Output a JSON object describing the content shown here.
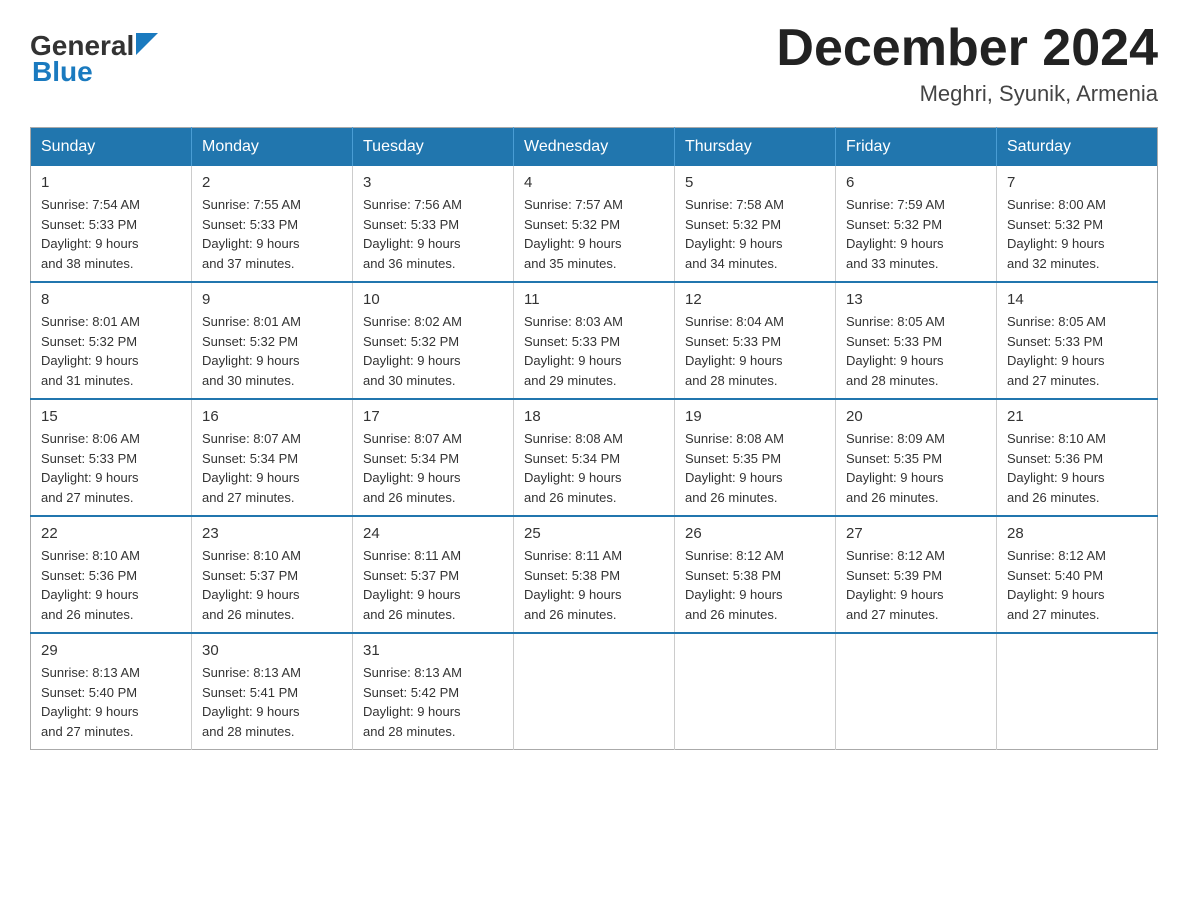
{
  "logo": {
    "general": "General",
    "blue": "Blue"
  },
  "title": "December 2024",
  "subtitle": "Meghri, Syunik, Armenia",
  "weekdays": [
    "Sunday",
    "Monday",
    "Tuesday",
    "Wednesday",
    "Thursday",
    "Friday",
    "Saturday"
  ],
  "weeks": [
    [
      {
        "day": "1",
        "sunrise": "7:54 AM",
        "sunset": "5:33 PM",
        "daylight": "9 hours and 38 minutes."
      },
      {
        "day": "2",
        "sunrise": "7:55 AM",
        "sunset": "5:33 PM",
        "daylight": "9 hours and 37 minutes."
      },
      {
        "day": "3",
        "sunrise": "7:56 AM",
        "sunset": "5:33 PM",
        "daylight": "9 hours and 36 minutes."
      },
      {
        "day": "4",
        "sunrise": "7:57 AM",
        "sunset": "5:32 PM",
        "daylight": "9 hours and 35 minutes."
      },
      {
        "day": "5",
        "sunrise": "7:58 AM",
        "sunset": "5:32 PM",
        "daylight": "9 hours and 34 minutes."
      },
      {
        "day": "6",
        "sunrise": "7:59 AM",
        "sunset": "5:32 PM",
        "daylight": "9 hours and 33 minutes."
      },
      {
        "day": "7",
        "sunrise": "8:00 AM",
        "sunset": "5:32 PM",
        "daylight": "9 hours and 32 minutes."
      }
    ],
    [
      {
        "day": "8",
        "sunrise": "8:01 AM",
        "sunset": "5:32 PM",
        "daylight": "9 hours and 31 minutes."
      },
      {
        "day": "9",
        "sunrise": "8:01 AM",
        "sunset": "5:32 PM",
        "daylight": "9 hours and 30 minutes."
      },
      {
        "day": "10",
        "sunrise": "8:02 AM",
        "sunset": "5:32 PM",
        "daylight": "9 hours and 30 minutes."
      },
      {
        "day": "11",
        "sunrise": "8:03 AM",
        "sunset": "5:33 PM",
        "daylight": "9 hours and 29 minutes."
      },
      {
        "day": "12",
        "sunrise": "8:04 AM",
        "sunset": "5:33 PM",
        "daylight": "9 hours and 28 minutes."
      },
      {
        "day": "13",
        "sunrise": "8:05 AM",
        "sunset": "5:33 PM",
        "daylight": "9 hours and 28 minutes."
      },
      {
        "day": "14",
        "sunrise": "8:05 AM",
        "sunset": "5:33 PM",
        "daylight": "9 hours and 27 minutes."
      }
    ],
    [
      {
        "day": "15",
        "sunrise": "8:06 AM",
        "sunset": "5:33 PM",
        "daylight": "9 hours and 27 minutes."
      },
      {
        "day": "16",
        "sunrise": "8:07 AM",
        "sunset": "5:34 PM",
        "daylight": "9 hours and 27 minutes."
      },
      {
        "day": "17",
        "sunrise": "8:07 AM",
        "sunset": "5:34 PM",
        "daylight": "9 hours and 26 minutes."
      },
      {
        "day": "18",
        "sunrise": "8:08 AM",
        "sunset": "5:34 PM",
        "daylight": "9 hours and 26 minutes."
      },
      {
        "day": "19",
        "sunrise": "8:08 AM",
        "sunset": "5:35 PM",
        "daylight": "9 hours and 26 minutes."
      },
      {
        "day": "20",
        "sunrise": "8:09 AM",
        "sunset": "5:35 PM",
        "daylight": "9 hours and 26 minutes."
      },
      {
        "day": "21",
        "sunrise": "8:10 AM",
        "sunset": "5:36 PM",
        "daylight": "9 hours and 26 minutes."
      }
    ],
    [
      {
        "day": "22",
        "sunrise": "8:10 AM",
        "sunset": "5:36 PM",
        "daylight": "9 hours and 26 minutes."
      },
      {
        "day": "23",
        "sunrise": "8:10 AM",
        "sunset": "5:37 PM",
        "daylight": "9 hours and 26 minutes."
      },
      {
        "day": "24",
        "sunrise": "8:11 AM",
        "sunset": "5:37 PM",
        "daylight": "9 hours and 26 minutes."
      },
      {
        "day": "25",
        "sunrise": "8:11 AM",
        "sunset": "5:38 PM",
        "daylight": "9 hours and 26 minutes."
      },
      {
        "day": "26",
        "sunrise": "8:12 AM",
        "sunset": "5:38 PM",
        "daylight": "9 hours and 26 minutes."
      },
      {
        "day": "27",
        "sunrise": "8:12 AM",
        "sunset": "5:39 PM",
        "daylight": "9 hours and 27 minutes."
      },
      {
        "day": "28",
        "sunrise": "8:12 AM",
        "sunset": "5:40 PM",
        "daylight": "9 hours and 27 minutes."
      }
    ],
    [
      {
        "day": "29",
        "sunrise": "8:13 AM",
        "sunset": "5:40 PM",
        "daylight": "9 hours and 27 minutes."
      },
      {
        "day": "30",
        "sunrise": "8:13 AM",
        "sunset": "5:41 PM",
        "daylight": "9 hours and 28 minutes."
      },
      {
        "day": "31",
        "sunrise": "8:13 AM",
        "sunset": "5:42 PM",
        "daylight": "9 hours and 28 minutes."
      },
      null,
      null,
      null,
      null
    ]
  ]
}
